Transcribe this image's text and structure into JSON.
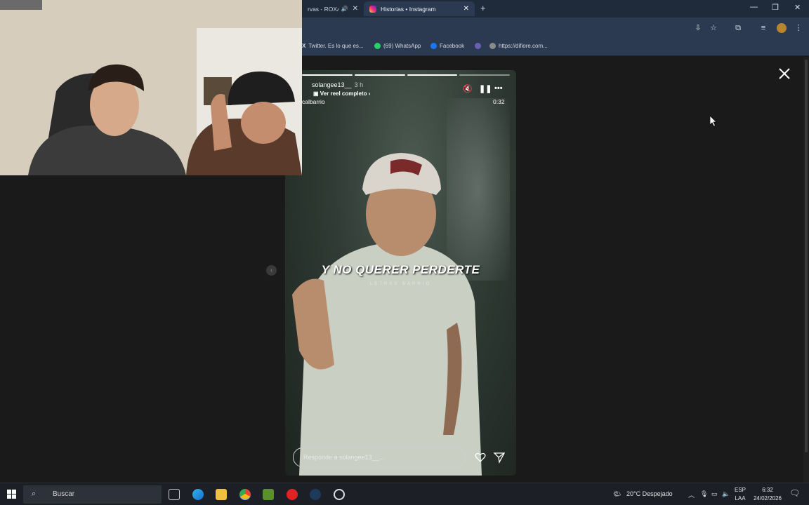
{
  "browser": {
    "tabs": [
      {
        "label": "rvas - ROXANA",
        "active": false
      },
      {
        "label": "Historias • Instagram",
        "active": true
      }
    ],
    "window_controls": [
      "—",
      "❐",
      "✕"
    ],
    "bookmarks": [
      "Twitter. Es lo que es...",
      "(69) WhatsApp",
      "Facebook",
      "https://difiore.com..."
    ]
  },
  "story": {
    "username": "solangee13__",
    "time": "3 h",
    "reel_link": "Ver reel completo",
    "music": "calbarrio",
    "duration": "0:32",
    "lyric": "Y NO QUERER PERDERTE",
    "lyric_sub": "LETRAS BARRIO",
    "progress_segments": 4,
    "progress_done": 3,
    "reply_placeholder": "Responde a solangee13__..."
  },
  "taskbar": {
    "search_placeholder": "Buscar",
    "weather": "20°C  Despejado",
    "lang_top": "ESP",
    "lang_bottom": "LAA",
    "time": "6:32",
    "date": "24/02/2026"
  }
}
